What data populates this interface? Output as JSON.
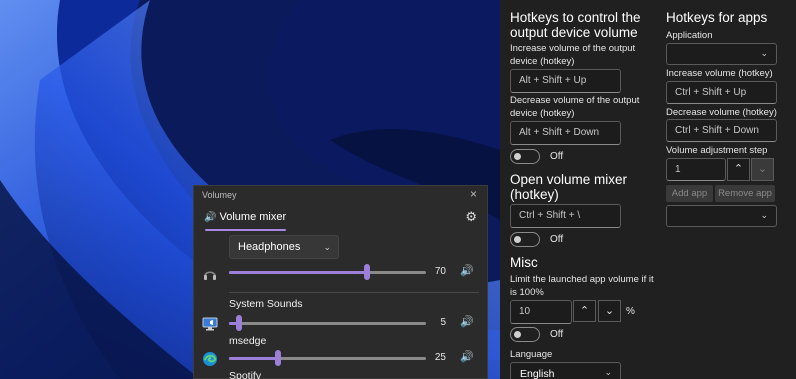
{
  "volumey": {
    "title": "Volumey",
    "tab_label": "Volume mixer",
    "device": "Headphones",
    "master": {
      "value": "70",
      "level": 0.7
    },
    "apps": [
      {
        "name": "System Sounds",
        "value": "5",
        "level": 0.05
      },
      {
        "name": "msedge",
        "value": "25",
        "level": 0.25
      },
      {
        "name": "Spotify"
      }
    ]
  },
  "settings": {
    "hotkeys_output": {
      "heading": "Hotkeys to control the output device volume",
      "increase_label": "Increase volume of the output device (hotkey)",
      "increase_value": "Alt + Shift + Up",
      "decrease_label": "Decrease volume of the output device (hotkey)",
      "decrease_value": "Alt + Shift + Down",
      "toggle_text": "Off"
    },
    "open_mixer": {
      "heading": "Open volume mixer (hotkey)",
      "value": "Ctrl + Shift + \\",
      "toggle_text": "Off"
    },
    "misc": {
      "heading": "Misc",
      "limit_label": "Limit the launched app volume if it is 100%",
      "limit_value": "10",
      "percent": "%",
      "toggle_text": "Off",
      "language_label": "Language",
      "language_value": "English"
    },
    "hotkeys_apps": {
      "heading": "Hotkeys for apps",
      "application_label": "Application",
      "increase_label": "Increase volume (hotkey)",
      "increase_value": "Ctrl + Shift + Up",
      "decrease_label": "Decrease volume (hotkey)",
      "decrease_value": "Ctrl + Shift + Down",
      "step_label": "Volume adjustment step",
      "step_value": "1",
      "add_app": "Add app",
      "remove_app": "Remove app"
    }
  }
}
